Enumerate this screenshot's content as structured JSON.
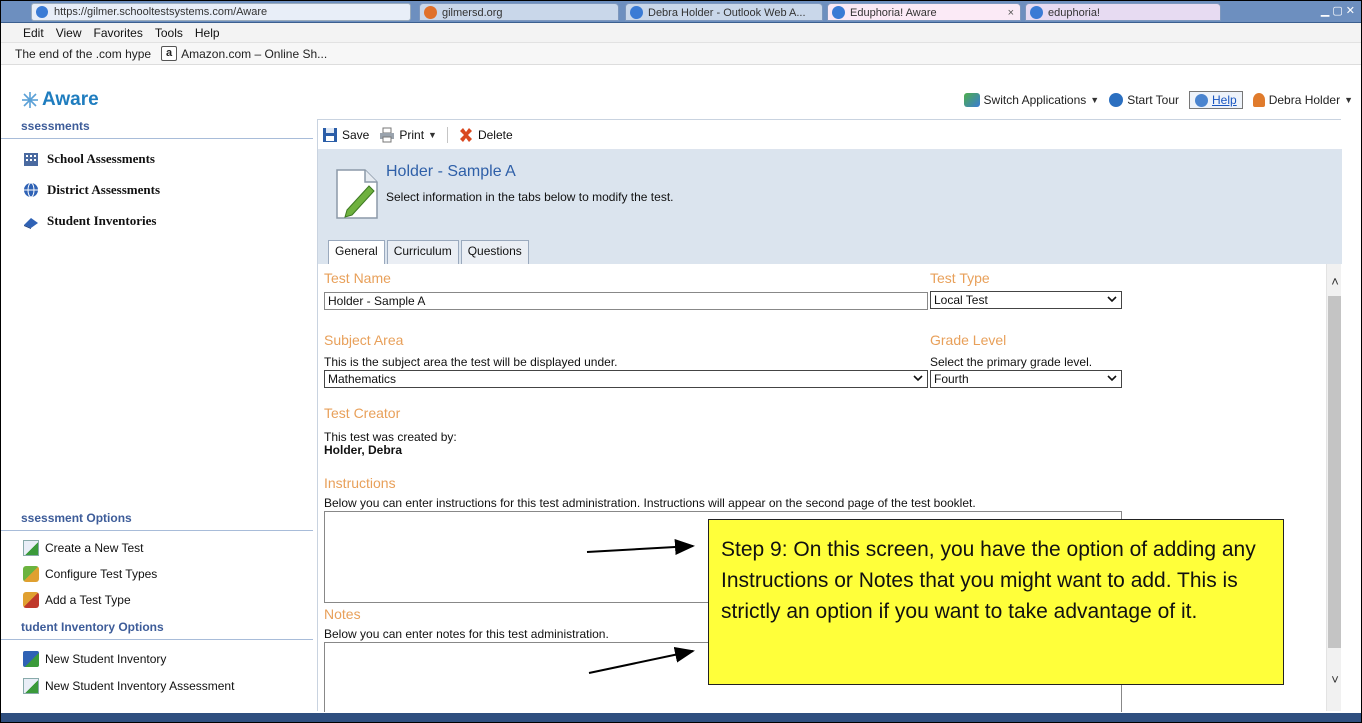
{
  "browser": {
    "url": "https://gilmer.schooltestsystems.com/Aware",
    "tabs": [
      {
        "label": "gilmersd.org"
      },
      {
        "label": "Debra Holder - Outlook Web A..."
      },
      {
        "label": "Eduphoria! Aware",
        "active": true
      },
      {
        "label": "eduphoria!"
      }
    ],
    "menu": [
      "Edit",
      "View",
      "Favorites",
      "Tools",
      "Help"
    ],
    "favorites": [
      {
        "label": "The end of the .com hype"
      },
      {
        "label": "Amazon.com – Online Sh...",
        "icon": "a"
      }
    ]
  },
  "app": {
    "logo": "Aware",
    "toplinks": {
      "switch": "Switch Applications",
      "tour": "Start Tour",
      "help": "Help",
      "user": "Debra Holder"
    }
  },
  "sidebar": {
    "assessments_heading": "ssessments",
    "assessments": [
      {
        "label": "School Assessments"
      },
      {
        "label": "District Assessments"
      },
      {
        "label": "Student Inventories"
      }
    ],
    "options_heading": "ssessment Options",
    "options": [
      {
        "label": "Create a New Test"
      },
      {
        "label": "Configure Test Types"
      },
      {
        "label": "Add a Test Type"
      }
    ],
    "inventory_heading": "tudent Inventory Options",
    "inventory": [
      {
        "label": "New Student Inventory"
      },
      {
        "label": "New Student Inventory Assessment"
      }
    ]
  },
  "toolbar": {
    "save": "Save",
    "print": "Print",
    "delete": "Delete"
  },
  "test": {
    "title": "Holder - Sample A",
    "subtitle": "Select information in the tabs below to modify the test.",
    "tabs": [
      "General",
      "Curriculum",
      "Questions"
    ]
  },
  "form": {
    "test_name_label": "Test Name",
    "test_name_value": "Holder - Sample A",
    "test_type_label": "Test Type",
    "test_type_value": "Local Test",
    "subject_label": "Subject Area",
    "subject_hint": "This is the subject area the test will be displayed under.",
    "subject_value": "Mathematics",
    "grade_label": "Grade Level",
    "grade_hint": "Select the primary grade level.",
    "grade_value": "Fourth",
    "creator_label": "Test Creator",
    "creator_hint": "This test was created by:",
    "creator_name": "Holder, Debra",
    "instructions_label": "Instructions",
    "instructions_hint": "Below you can enter instructions for this test administration. Instructions will appear on the second page of the test booklet.",
    "notes_label": "Notes",
    "notes_hint": "Below you can enter notes for this test administration."
  },
  "annotation": {
    "text": "Step 9:  On this screen, you have the option of adding any Instructions or Notes that you might want to add.  This is strictly an option if you want to take advantage of it."
  }
}
